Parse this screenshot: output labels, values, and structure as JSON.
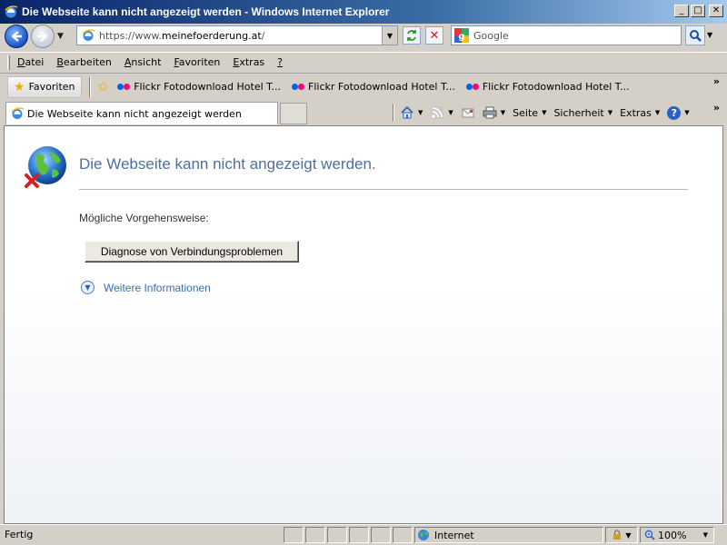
{
  "window": {
    "title": "Die Webseite kann nicht angezeigt werden - Windows Internet Explorer",
    "minimize_glyph": "_",
    "maximize_glyph": "□",
    "close_glyph": "✕"
  },
  "address_bar": {
    "url_prefix": "https://www.",
    "url_domain": "meinefoerderung.at",
    "url_suffix": "/"
  },
  "search": {
    "provider": "Google",
    "placeholder": "Google"
  },
  "menu": [
    {
      "label_first": "D",
      "label_rest": "atei"
    },
    {
      "label_first": "B",
      "label_rest": "earbeiten"
    },
    {
      "label_first": "A",
      "label_rest": "nsicht"
    },
    {
      "label_first": "F",
      "label_rest": "avoriten"
    },
    {
      "label_first": "E",
      "label_rest": "xtras"
    },
    {
      "label_first": "?",
      "label_rest": ""
    }
  ],
  "favorites": {
    "button_label": "Favoriten",
    "links": [
      "Flickr Fotodownload Hotel T...",
      "Flickr Fotodownload Hotel T...",
      "Flickr Fotodownload Hotel T..."
    ],
    "overflow_glyph": "»"
  },
  "tabs": {
    "active_label": "Die Webseite kann nicht angezeigt werden"
  },
  "commands": {
    "page_label": "Seite",
    "safety_label": "Sicherheit",
    "extras_label": "Extras",
    "overflow_glyph": "»"
  },
  "error_page": {
    "title": "Die Webseite kann nicht angezeigt werden.",
    "steps_label": "Mögliche Vorgehensweise:",
    "diagnose_button": "Diagnose von Verbindungsproblemen",
    "more_info_link": "Weitere Informationen"
  },
  "status_bar": {
    "text": "Fertig",
    "zone": "Internet",
    "zoom": "100%"
  },
  "colors": {
    "title_gradient_start": "#0a246a",
    "error_title": "#4d6fa0",
    "link": "#3a6db1"
  }
}
